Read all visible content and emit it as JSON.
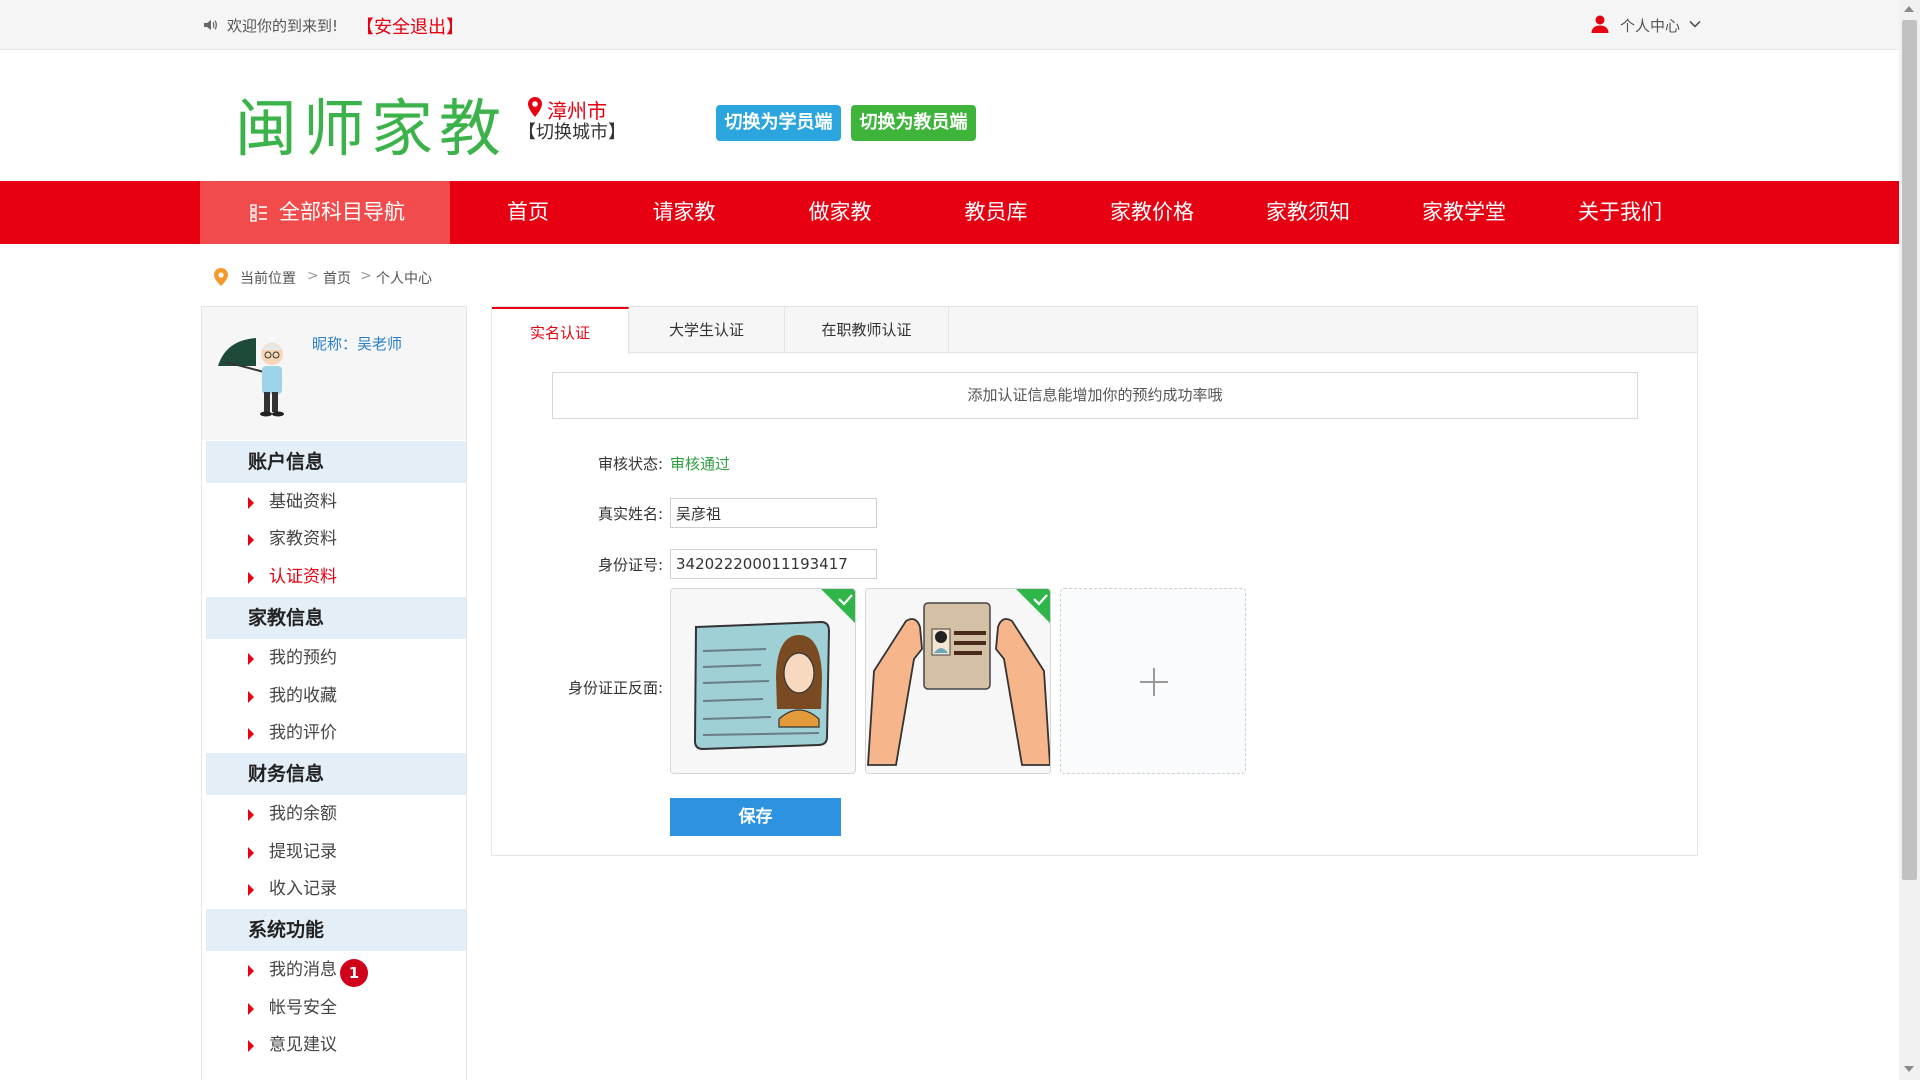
{
  "topbar": {
    "welcome": "欢迎你的到来到!",
    "logout": "【安全退出】",
    "personal_center": "个人中心"
  },
  "header": {
    "logo": "闽师家教",
    "city": "漳州市",
    "switch_city": "【切换城市】",
    "switch_student": "切换为学员端",
    "switch_teacher": "切换为教员端"
  },
  "nav": {
    "all_subjects": "全部科目导航",
    "items": [
      "首页",
      "请家教",
      "做家教",
      "教员库",
      "家教价格",
      "家教须知",
      "家教学堂",
      "关于我们"
    ]
  },
  "breadcrumb": [
    "当前位置",
    "首页",
    "个人中心"
  ],
  "sidebar": {
    "nickname": "昵称：吴老师",
    "sections": [
      {
        "title": "账户信息",
        "items": [
          "基础资料",
          "家教资料",
          "认证资料"
        ]
      },
      {
        "title": "家教信息",
        "items": [
          "我的预约",
          "我的收藏",
          "我的评价"
        ]
      },
      {
        "title": "财务信息",
        "items": [
          "我的余额",
          "提现记录",
          "收入记录"
        ]
      },
      {
        "title": "系统功能",
        "items": [
          "我的消息",
          "帐号安全",
          "意见建议"
        ]
      }
    ],
    "message_badge": "1",
    "active_item": "认证资料"
  },
  "tabs": [
    "实名认证",
    "大学生认证",
    "在职教师认证"
  ],
  "form": {
    "notice": "添加认证信息能增加你的预约成功率哦",
    "status_label": "审核状态:",
    "status_value": "审核通过",
    "name_label": "真实姓名:",
    "name_value": "吴彦祖",
    "id_label": "身份证号:",
    "id_value": "342022200011193417",
    "photo_label": "身份证正反面:",
    "save": "保存"
  },
  "colors": {
    "brand_red": "#e60012",
    "logo_green": "#3cb34a",
    "student_blue": "#2aa5dd",
    "teacher_green": "#3fb43b",
    "save_blue": "#2d93e0",
    "status_green": "#2f9e3f"
  }
}
